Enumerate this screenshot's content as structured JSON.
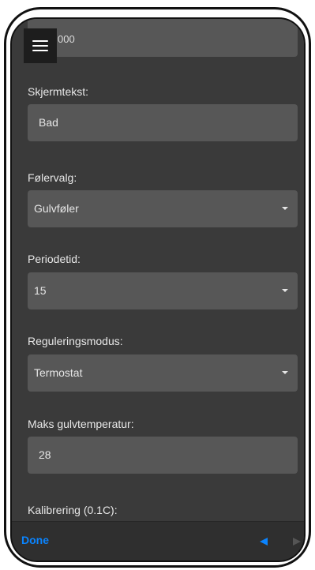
{
  "form": {
    "top_field_value": "000",
    "screen_text": {
      "label": "Skjermtekst:",
      "value": "Bad"
    },
    "sensor_choice": {
      "label": "Følervalg:",
      "value": "Gulvføler"
    },
    "period_time": {
      "label": "Periodetid:",
      "value": "15"
    },
    "regulation_mode": {
      "label": "Reguleringsmodus:",
      "value": "Termostat"
    },
    "max_floor_temp": {
      "label": "Maks gulvtemperatur:",
      "value": "28"
    },
    "calibration": {
      "label": "Kalibrering (0.1C):"
    }
  },
  "keyboard_bar": {
    "done_label": "Done"
  },
  "icons": {
    "menu": "hamburger-icon",
    "caret": "chevron-down-icon",
    "prev": "arrow-left-icon",
    "next": "arrow-right-icon"
  },
  "colors": {
    "background": "#3a3a3a",
    "field": "#575757",
    "accent": "#0a84ff"
  }
}
